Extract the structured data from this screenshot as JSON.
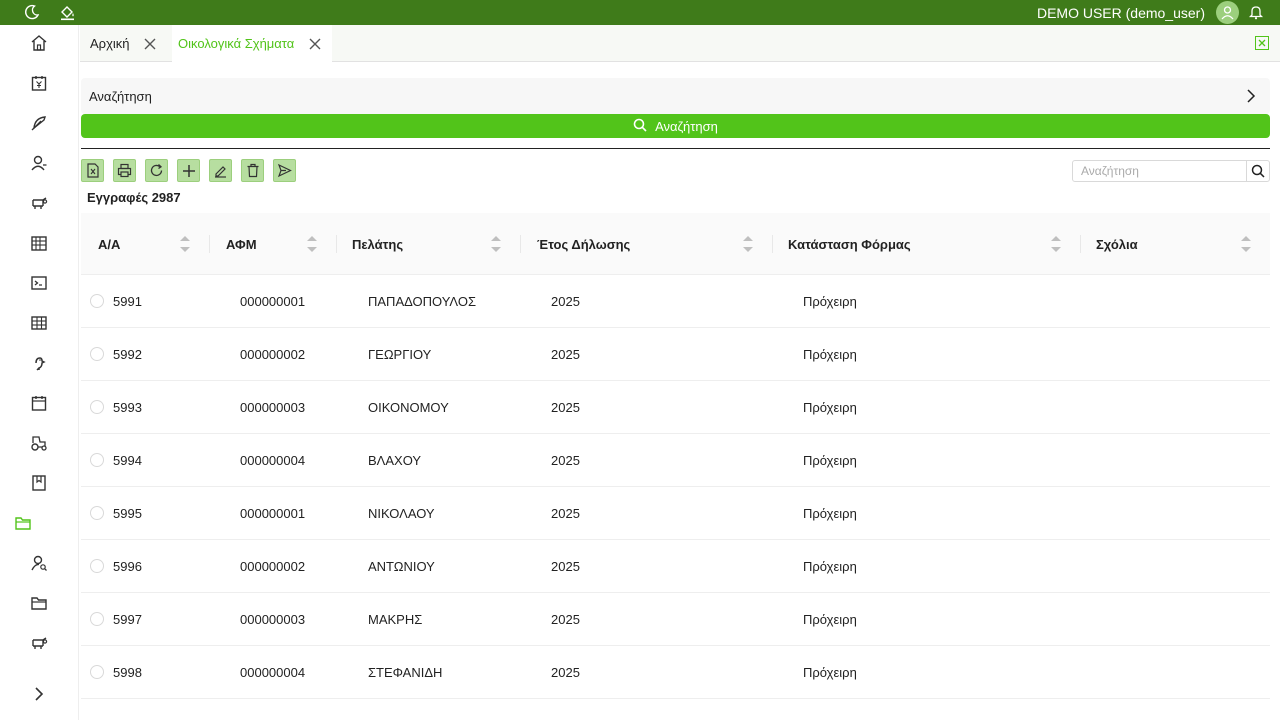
{
  "header": {
    "user_label": "DEMO USER (demo_user)"
  },
  "icons": {
    "topbar": [
      "moon-icon",
      "paint-bucket-icon",
      "avatar-icon",
      "bell-icon"
    ],
    "sidebar": [
      "home-icon",
      "calendar-yen-icon",
      "feather-icon",
      "user-icon",
      "cow-icon",
      "building-icon",
      "terminal-icon",
      "table-icon",
      "bird-icon",
      "calendar-icon",
      "tractor-icon",
      "book-icon",
      "folder-icon",
      "user-search-icon",
      "folder-icon",
      "cow-icon",
      "chevron-right-icon"
    ]
  },
  "tabs": [
    {
      "label": "Αρχική",
      "active": false
    },
    {
      "label": "Οικολογικά Σχήματα",
      "active": true
    }
  ],
  "search_panel": {
    "label": "Αναζήτηση",
    "button_label": "Αναζήτηση"
  },
  "toolbar": {
    "buttons": [
      "excel-export-icon",
      "print-icon",
      "refresh-icon",
      "add-icon",
      "edit-icon",
      "delete-icon",
      "send-icon"
    ],
    "records_label": "Εγγραφές 2987",
    "search_placeholder": "Αναζήτηση"
  },
  "table": {
    "columns": [
      "Α/Α",
      "ΑΦΜ",
      "Πελάτης",
      "Έτος Δήλωσης",
      "Κατάσταση Φόρμας",
      "Σχόλια"
    ],
    "rows": [
      {
        "aa": "5991",
        "afm": "000000001",
        "client": "ΠΑΠΑΔΟΠΟΥΛΟΣ",
        "year": "2025",
        "status": "Πρόχειρη",
        "comments": ""
      },
      {
        "aa": "5992",
        "afm": "000000002",
        "client": "ΓΕΩΡΓΙΟΥ",
        "year": "2025",
        "status": "Πρόχειρη",
        "comments": ""
      },
      {
        "aa": "5993",
        "afm": "000000003",
        "client": "ΟΙΚΟΝΟΜΟΥ",
        "year": "2025",
        "status": "Πρόχειρη",
        "comments": ""
      },
      {
        "aa": "5994",
        "afm": "000000004",
        "client": "ΒΛΑΧΟΥ",
        "year": "2025",
        "status": "Πρόχειρη",
        "comments": ""
      },
      {
        "aa": "5995",
        "afm": "000000001",
        "client": "ΝΙΚΟΛΑΟΥ",
        "year": "2025",
        "status": "Πρόχειρη",
        "comments": ""
      },
      {
        "aa": "5996",
        "afm": "000000002",
        "client": "ΑΝΤΩΝΙΟΥ",
        "year": "2025",
        "status": "Πρόχειρη",
        "comments": ""
      },
      {
        "aa": "5997",
        "afm": "000000003",
        "client": "ΜΑΚΡΗΣ",
        "year": "2025",
        "status": "Πρόχειρη",
        "comments": ""
      },
      {
        "aa": "5998",
        "afm": "000000004",
        "client": "ΣΤΕΦΑΝΙΔΗ",
        "year": "2025",
        "status": "Πρόχειρη",
        "comments": ""
      }
    ]
  },
  "colors": {
    "topbar": "#3f7b1a",
    "accent": "#52c41a",
    "tool_button": "#b7dea0"
  }
}
